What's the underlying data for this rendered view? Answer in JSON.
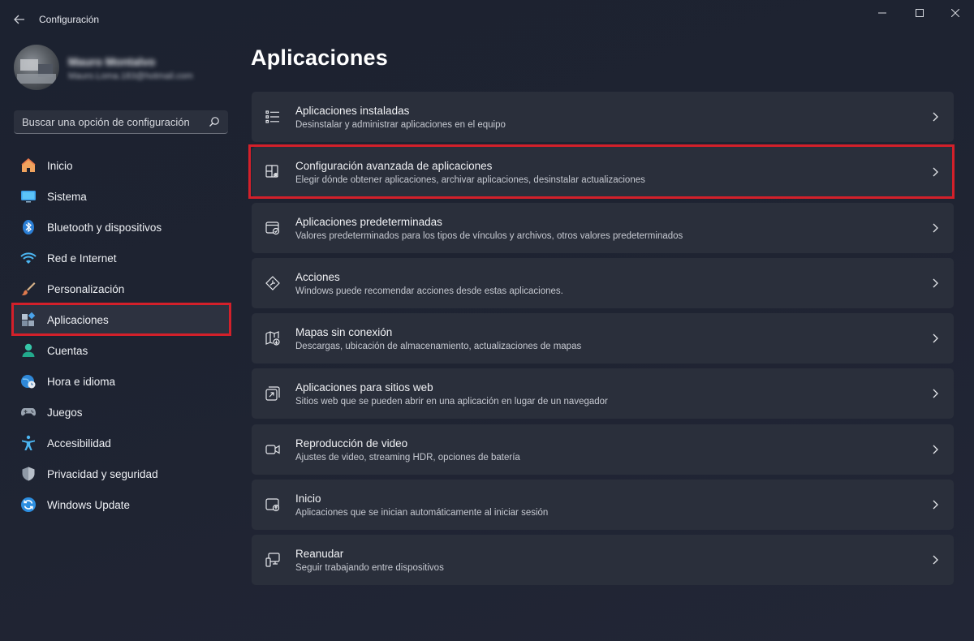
{
  "window": {
    "title": "Configuración",
    "back_icon": "arrow-left-icon",
    "controls": [
      "minimize-icon",
      "maximize-icon",
      "close-icon"
    ]
  },
  "profile": {
    "name": "Mauro Montalvo",
    "email": "Mauro.Loma.183@hotmail.com"
  },
  "search": {
    "placeholder": "Buscar una opción de configuración",
    "icon": "search-icon"
  },
  "sidebar": {
    "items": [
      {
        "label": "Inicio",
        "icon": "home-icon"
      },
      {
        "label": "Sistema",
        "icon": "monitor-icon"
      },
      {
        "label": "Bluetooth y dispositivos",
        "icon": "bluetooth-icon"
      },
      {
        "label": "Red e Internet",
        "icon": "wifi-icon"
      },
      {
        "label": "Personalización",
        "icon": "brush-icon"
      },
      {
        "label": "Aplicaciones",
        "icon": "apps-icon",
        "active": true
      },
      {
        "label": "Cuentas",
        "icon": "person-icon"
      },
      {
        "label": "Hora e idioma",
        "icon": "globe-clock-icon"
      },
      {
        "label": "Juegos",
        "icon": "gamepad-icon"
      },
      {
        "label": "Accesibilidad",
        "icon": "accessibility-icon"
      },
      {
        "label": "Privacidad y seguridad",
        "icon": "shield-icon"
      },
      {
        "label": "Windows Update",
        "icon": "update-icon"
      }
    ]
  },
  "main": {
    "title": "Aplicaciones",
    "cards": [
      {
        "title": "Aplicaciones instaladas",
        "subtitle": "Desinstalar y administrar aplicaciones en el equipo",
        "icon": "list-icon"
      },
      {
        "title": "Configuración avanzada de aplicaciones",
        "subtitle": "Elegir dónde obtener aplicaciones, archivar aplicaciones, desinstalar actualizaciones",
        "icon": "apps-gear-icon",
        "highlighted": true
      },
      {
        "title": "Aplicaciones predeterminadas",
        "subtitle": "Valores predeterminados para los tipos de vínculos y archivos, otros valores predeterminados",
        "icon": "default-apps-icon"
      },
      {
        "title": "Acciones",
        "subtitle": "Windows puede recomendar acciones desde estas aplicaciones.",
        "icon": "actions-icon"
      },
      {
        "title": "Mapas sin conexión",
        "subtitle": "Descargas, ubicación de almacenamiento, actualizaciones de mapas",
        "icon": "map-download-icon"
      },
      {
        "title": "Aplicaciones para sitios web",
        "subtitle": "Sitios web que se pueden abrir en una aplicación en lugar de un navegador",
        "icon": "open-external-icon"
      },
      {
        "title": "Reproducción de video",
        "subtitle": "Ajustes de video, streaming HDR, opciones de batería",
        "icon": "video-icon"
      },
      {
        "title": "Inicio",
        "subtitle": "Aplicaciones que se inician automáticamente al iniciar sesión",
        "icon": "startup-icon"
      },
      {
        "title": "Reanudar",
        "subtitle": "Seguir trabajando entre dispositivos",
        "icon": "resume-devices-icon"
      }
    ]
  },
  "colors": {
    "background": "#1e2331",
    "card": "#2a2f3b",
    "highlight": "#d3202a",
    "accent": "#4cc2ff"
  }
}
